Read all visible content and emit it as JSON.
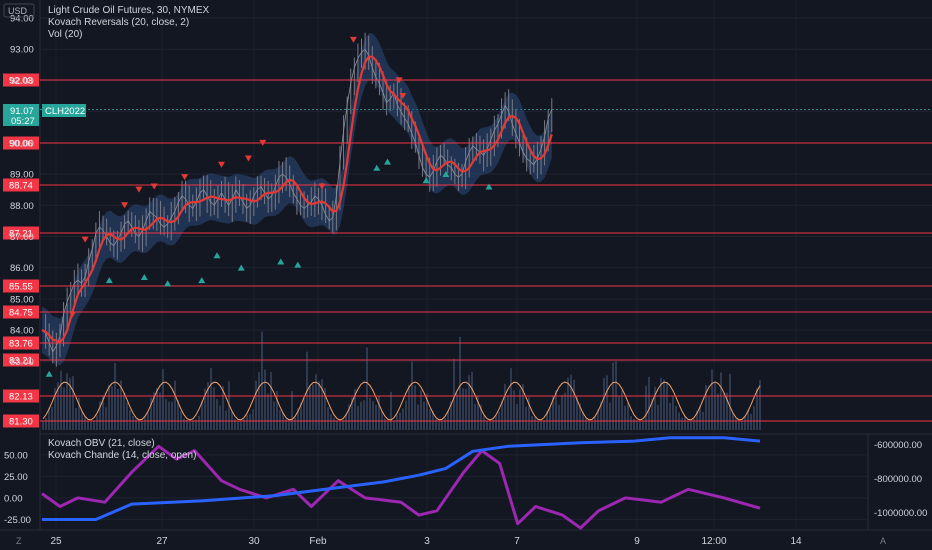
{
  "chart_data": {
    "type": "line",
    "currency_label": "USD",
    "legend": {
      "instrument": "Light Crude Oil Futures, 30, NYMEX",
      "indicator1": "Kovach Reversals (20, close, 2)",
      "indicator2": "Vol (20)",
      "sub_indicator1": "Kovach OBV (21, close)",
      "sub_indicator2": "Kovach Chande (14, close, open)"
    },
    "price_axis": {
      "ticks": [
        "94.00",
        "93.00",
        "92.00",
        "91.00",
        "90.00",
        "89.00",
        "88.00",
        "87.00",
        "86.00",
        "85.00",
        "84.00",
        "83.00"
      ],
      "range": [
        82.85,
        94.0
      ]
    },
    "x_ticks": [
      "25",
      "27",
      "30",
      "Feb",
      "3",
      "7",
      "9",
      "12:00",
      "14"
    ],
    "levels": [
      "92.03",
      "90.06",
      "88.74",
      "87.21",
      "85.55",
      "84.75",
      "83.76",
      "83.21",
      "82.13",
      "81.30"
    ],
    "current_price": {
      "value": "91.07",
      "countdown": "05:27",
      "symbol": "CLH2022",
      "color": "#26a69a"
    },
    "price_series": {
      "x": [
        0,
        4,
        8,
        12,
        16,
        20,
        24,
        28,
        32,
        36,
        40,
        44,
        48,
        52,
        56,
        60,
        64,
        68,
        72,
        76,
        80,
        84,
        88,
        92,
        96,
        100,
        104,
        108,
        112,
        116,
        120,
        124,
        128,
        132,
        136,
        140,
        144,
        148,
        152,
        156,
        160,
        164,
        168,
        172,
        176,
        180,
        184,
        188,
        192,
        196,
        200,
        204,
        208,
        212,
        216,
        220,
        224,
        228,
        232,
        236,
        240,
        244,
        248,
        252,
        256,
        260,
        264,
        268,
        272,
        276,
        280,
        284,
        288,
        292,
        296,
        300,
        304,
        308,
        312,
        316,
        320,
        324,
        328,
        332,
        336,
        340,
        344,
        348,
        352,
        356,
        360,
        364,
        368,
        372,
        376,
        380,
        384,
        388,
        392,
        396,
        400,
        404,
        408,
        412,
        416,
        420,
        424,
        428,
        432,
        436,
        440,
        444,
        448,
        452,
        456,
        460,
        464,
        468,
        472,
        476,
        480,
        484,
        488,
        492,
        496,
        500,
        504,
        508,
        512,
        516,
        520,
        524,
        528,
        532,
        536,
        540,
        544,
        548,
        552,
        556,
        560,
        564,
        568,
        572,
        576,
        580,
        584,
        588,
        592,
        596,
        600,
        604,
        608,
        612,
        616,
        620,
        624,
        628,
        632,
        636,
        640,
        644,
        648,
        652,
        656,
        660,
        664,
        668,
        672,
        676,
        680,
        684,
        688,
        692,
        696,
        700,
        704,
        708,
        712,
        716,
        720,
        724,
        728,
        732,
        736,
        740,
        744,
        748,
        752,
        756,
        760,
        764,
        768,
        772,
        776,
        780,
        784,
        788,
        792,
        796,
        800
      ],
      "close": [
        84.0,
        83.9,
        83.6,
        83.3,
        83.5,
        83.8,
        84.5,
        84.9,
        85.2,
        85.5,
        85.6,
        85.5,
        85.7,
        86.2,
        86.6,
        87.1,
        87.3,
        87.2,
        87.0,
        86.8,
        86.7,
        86.9,
        87.1,
        87.4,
        87.5,
        87.3,
        87.1,
        87.0,
        87.2,
        87.5,
        87.8,
        87.7,
        87.6,
        87.4,
        87.3,
        87.4,
        87.6,
        87.8,
        88.1,
        88.3,
        88.2,
        88.0,
        87.9,
        88.1,
        88.4,
        88.5,
        88.3,
        88.1,
        88.0,
        88.2,
        88.4,
        88.2,
        88.0,
        88.2,
        88.5,
        88.3,
        88.1,
        87.9,
        88.0,
        88.3,
        88.5,
        88.6,
        88.4,
        88.2,
        88.3,
        88.6,
        88.9,
        89.0,
        88.9,
        88.7,
        88.4,
        88.2,
        88.0,
        87.9,
        88.0,
        88.1,
        88.3,
        88.2,
        88.0,
        87.7,
        87.5,
        87.6,
        88.3,
        89.4,
        90.4,
        91.2,
        91.9,
        92.4,
        92.7,
        92.9,
        93.0,
        92.8,
        92.4,
        92.1,
        91.9,
        91.6,
        91.3,
        91.4,
        91.6,
        91.2,
        91.0,
        90.8,
        90.6,
        90.3,
        90.0,
        89.6,
        89.2,
        89.0,
        88.9,
        89.1,
        89.4,
        89.6,
        89.5,
        89.3,
        89.2,
        89.0,
        88.9,
        89.0,
        89.4,
        89.7,
        89.9,
        89.8,
        89.7,
        89.6,
        89.8,
        90.1,
        90.4,
        90.6,
        90.9,
        91.2,
        91.0,
        90.6,
        90.3,
        90.0,
        89.7,
        89.5,
        89.4,
        89.3,
        89.5,
        89.8,
        90.2,
        90.8,
        91.07
      ],
      "line_color": "#e53935",
      "price_color": "#787b86"
    },
    "obv_axis": {
      "ticks": [
        "-600000.00",
        "-800000.00",
        "-1000000.00"
      ],
      "range": [
        -1090000,
        -550000
      ]
    },
    "chande_axis": {
      "ticks": [
        "50.00",
        "25.00",
        "0.00",
        "-25.00"
      ],
      "range": [
        -35,
        72
      ]
    },
    "obv_series": {
      "color": "#2962ff",
      "x": [
        0,
        60,
        100,
        180,
        260,
        320,
        380,
        420,
        450,
        480,
        520,
        600,
        660,
        700,
        760,
        800
      ],
      "values": [
        -1040000,
        -1040000,
        -950000,
        -930000,
        -900000,
        -860000,
        -820000,
        -780000,
        -740000,
        -640000,
        -610000,
        -590000,
        -580000,
        -560000,
        -560000,
        -580000
      ]
    },
    "chande_series": {
      "color": "#9c27b0",
      "x": [
        0,
        20,
        40,
        70,
        100,
        130,
        150,
        170,
        200,
        220,
        250,
        280,
        300,
        330,
        360,
        400,
        420,
        440,
        470,
        490,
        510,
        530,
        550,
        580,
        600,
        620,
        650,
        690,
        720,
        760,
        800
      ],
      "values": [
        5,
        -10,
        0,
        -5,
        30,
        60,
        45,
        55,
        20,
        10,
        0,
        10,
        -10,
        20,
        0,
        -5,
        -20,
        -15,
        30,
        55,
        40,
        -30,
        -10,
        -20,
        -35,
        -15,
        0,
        -5,
        10,
        0,
        -12
      ]
    },
    "markers": {
      "sell_color": "#e53935",
      "buy_color": "#26a69a",
      "down": [
        [
          34,
          84.5
        ],
        [
          48,
          86.9
        ],
        [
          92,
          88.0
        ],
        [
          108,
          88.5
        ],
        [
          125,
          88.6
        ],
        [
          159,
          88.9
        ],
        [
          200,
          89.3
        ],
        [
          230,
          89.5
        ],
        [
          246,
          90.0
        ],
        [
          312,
          88.6
        ],
        [
          347,
          93.3
        ],
        [
          398,
          92.0
        ],
        [
          402,
          91.5
        ]
      ],
      "up": [
        [
          8,
          82.6
        ],
        [
          75,
          85.6
        ],
        [
          114,
          85.7
        ],
        [
          140,
          85.5
        ],
        [
          178,
          85.6
        ],
        [
          195,
          86.4
        ],
        [
          222,
          86.0
        ],
        [
          266,
          86.2
        ],
        [
          285,
          86.1
        ],
        [
          373,
          89.2
        ],
        [
          385,
          89.4
        ],
        [
          428,
          88.8
        ],
        [
          450,
          89.0
        ],
        [
          498,
          88.6
        ]
      ]
    },
    "volume": {
      "color": "#3a4660",
      "ma_color": "#f2a16b"
    }
  }
}
